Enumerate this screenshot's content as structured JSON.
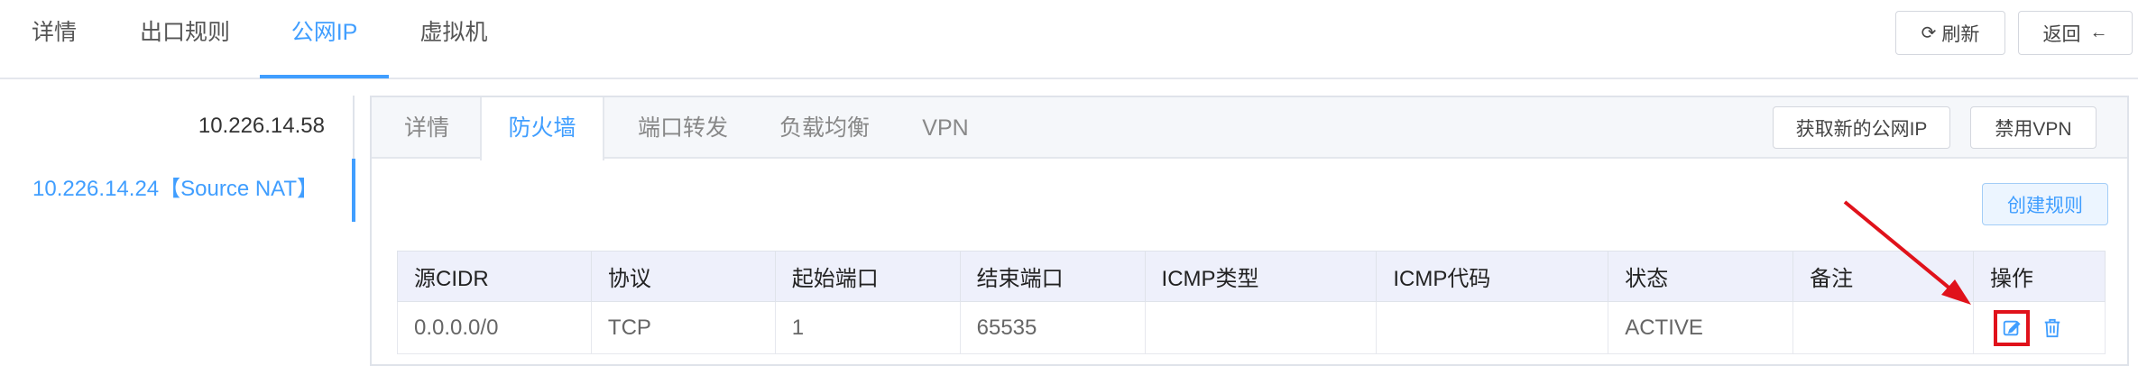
{
  "top_nav": {
    "tabs": [
      "详情",
      "出口规则",
      "公网IP",
      "虚拟机"
    ],
    "active_index": 2,
    "refresh_label": "刷新",
    "back_label": "返回"
  },
  "ip_list": {
    "items": [
      "10.226.14.58",
      "10.226.14.24【Source NAT】"
    ],
    "active_index": 1
  },
  "inner_nav": {
    "tabs": [
      "详情",
      "防火墙",
      "端口转发",
      "负载均衡",
      "VPN"
    ],
    "active_index": 1,
    "get_new_ip_label": "获取新的公网IP",
    "disable_vpn_label": "禁用VPN"
  },
  "firewall": {
    "create_rule_label": "创建规则",
    "columns": [
      "源CIDR",
      "协议",
      "起始端口",
      "结束端口",
      "ICMP类型",
      "ICMP代码",
      "状态",
      "备注",
      "操作"
    ],
    "rows": [
      [
        "0.0.0.0/0",
        "TCP",
        "1",
        "65535",
        "",
        "",
        "ACTIVE",
        ""
      ]
    ]
  },
  "colors": {
    "accent": "#409eff",
    "highlight": "#e0121b"
  },
  "icons": [
    "refresh-icon",
    "back-arrow-icon",
    "edit-icon",
    "delete-icon"
  ]
}
